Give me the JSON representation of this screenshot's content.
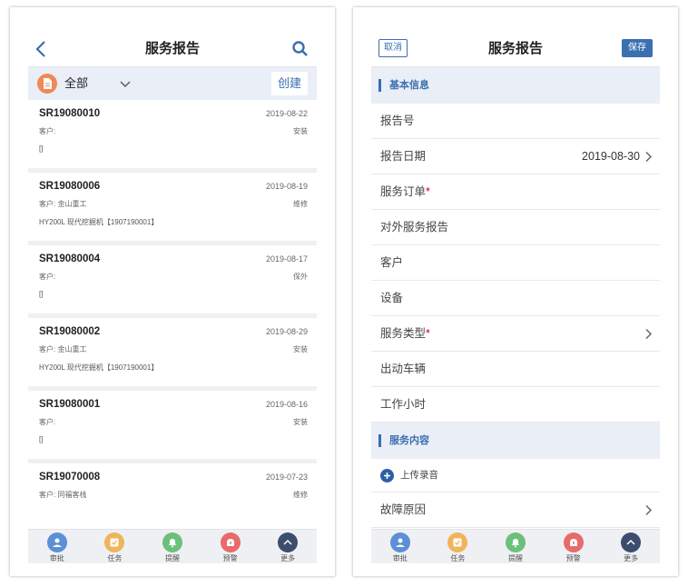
{
  "left": {
    "header": {
      "title": "服务报告"
    },
    "filter": {
      "label": "全部",
      "create_label": "创建"
    },
    "reports": [
      {
        "id": "SR19080010",
        "date": "2019-08-22",
        "customer": "客户:",
        "type": "安装",
        "equipment": "[]"
      },
      {
        "id": "SR19080006",
        "date": "2019-08-19",
        "customer": "客户: 金山重工",
        "type": "维修",
        "equipment": "HY200L 现代挖掘机【1907190001】"
      },
      {
        "id": "SR19080004",
        "date": "2019-08-17",
        "customer": "客户:",
        "type": "保外",
        "equipment": "[]"
      },
      {
        "id": "SR19080002",
        "date": "2019-08-29",
        "customer": "客户: 金山重工",
        "type": "安装",
        "equipment": "HY200L 现代挖掘机【1907190001】"
      },
      {
        "id": "SR19080001",
        "date": "2019-08-16",
        "customer": "客户:",
        "type": "安装",
        "equipment": "[]"
      },
      {
        "id": "SR19070008",
        "date": "2019-07-23",
        "customer": "客户: 同福客栈",
        "type": "维修",
        "equipment": ""
      }
    ]
  },
  "right": {
    "header": {
      "title": "服务报告",
      "cancel_label": "取消",
      "save_label": "保存"
    },
    "section_basic": "基本信息",
    "fields": {
      "report_no": "报告号",
      "report_date": "报告日期",
      "report_date_value": "2019-08-30",
      "service_order": "服务订单",
      "external_report": "对外服务报告",
      "customer": "客户",
      "equipment": "设备",
      "service_type": "服务类型",
      "vehicle": "出动车辆",
      "work_hours": "工作小时"
    },
    "required_mark": "*",
    "section_content": "服务内容",
    "upload_label": "上传录音",
    "fault_cause": "故障原因"
  },
  "tabbar": [
    {
      "label": "审批",
      "color": "#5b8fd6"
    },
    {
      "label": "任务",
      "color": "#f0b45a"
    },
    {
      "label": "提醒",
      "color": "#6cc07a"
    },
    {
      "label": "预警",
      "color": "#e86a6a"
    },
    {
      "label": "更多",
      "color": "#3d4d6e"
    }
  ],
  "colors": {
    "accent": "#3a6fb0",
    "section_bg": "#eaeef6",
    "required": "#d0021b"
  }
}
